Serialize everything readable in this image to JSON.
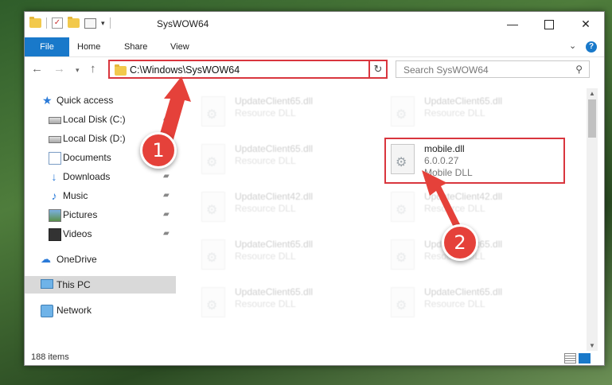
{
  "window": {
    "title": "SysWOW64",
    "controls": {
      "minimize": "—",
      "maximize": "",
      "close": "✕"
    }
  },
  "quick_access_toolbar": {
    "dropdown": "▾"
  },
  "ribbon": {
    "tabs": [
      "File",
      "Home",
      "Share",
      "View"
    ],
    "expand": "⌄",
    "help": "?"
  },
  "navigation": {
    "back": "←",
    "forward": "→",
    "recent": "▾",
    "up": "↑",
    "address": "C:\\Windows\\SysWOW64",
    "address_dropdown": "⌄",
    "refresh": "↻",
    "search_placeholder": "Search SysWOW64",
    "search_icon": "⚲"
  },
  "sidebar": {
    "items": [
      {
        "label": "Quick access",
        "icon": "star-icon"
      },
      {
        "label": "Local Disk (C:)",
        "icon": "drive-icon",
        "pinned": true
      },
      {
        "label": "Local Disk (D:)",
        "icon": "drive-icon",
        "pinned": true
      },
      {
        "label": "Documents",
        "icon": "documents-icon",
        "pinned": true
      },
      {
        "label": "Downloads",
        "icon": "download-icon",
        "pinned": true
      },
      {
        "label": "Music",
        "icon": "music-icon",
        "pinned": true
      },
      {
        "label": "Pictures",
        "icon": "pictures-icon",
        "pinned": true
      },
      {
        "label": "Videos",
        "icon": "video-icon",
        "pinned": true
      },
      {
        "label": "OneDrive",
        "icon": "cloud-icon"
      },
      {
        "label": "This PC",
        "icon": "computer-icon",
        "selected": true
      },
      {
        "label": "Network",
        "icon": "network-icon"
      }
    ],
    "pin_glyph": "📌"
  },
  "files": [
    {
      "name": "UpdateClient65.dll",
      "type": "Resource DLL"
    },
    {
      "name": "UpdateClient65.dll",
      "type": "Resource DLL"
    },
    {
      "name": "UpdateClient65.dll",
      "type": "Resource DLL"
    },
    {
      "name": "mobile.dll",
      "version": "6.0.0.27",
      "type": "Mobile DLL"
    },
    {
      "name": "UpdateClient42.dll",
      "type": "Resource DLL"
    },
    {
      "name": "UpdateClient42.dll",
      "type": "Resource DLL"
    },
    {
      "name": "UpdateClient65.dll",
      "type": "Resource DLL"
    },
    {
      "name": "UpdateClient65.dll",
      "type": "Resource DLL"
    },
    {
      "name": "UpdateClient65.dll",
      "type": "Resource DLL"
    },
    {
      "name": "UpdateClient65.dll",
      "type": "Resource DLL"
    }
  ],
  "status": {
    "item_count": "188 items"
  },
  "annotations": {
    "marker1": "1",
    "marker2": "2"
  },
  "colors": {
    "accent": "#1979ca",
    "highlight": "#d9363e",
    "marker": "#e5413a"
  }
}
